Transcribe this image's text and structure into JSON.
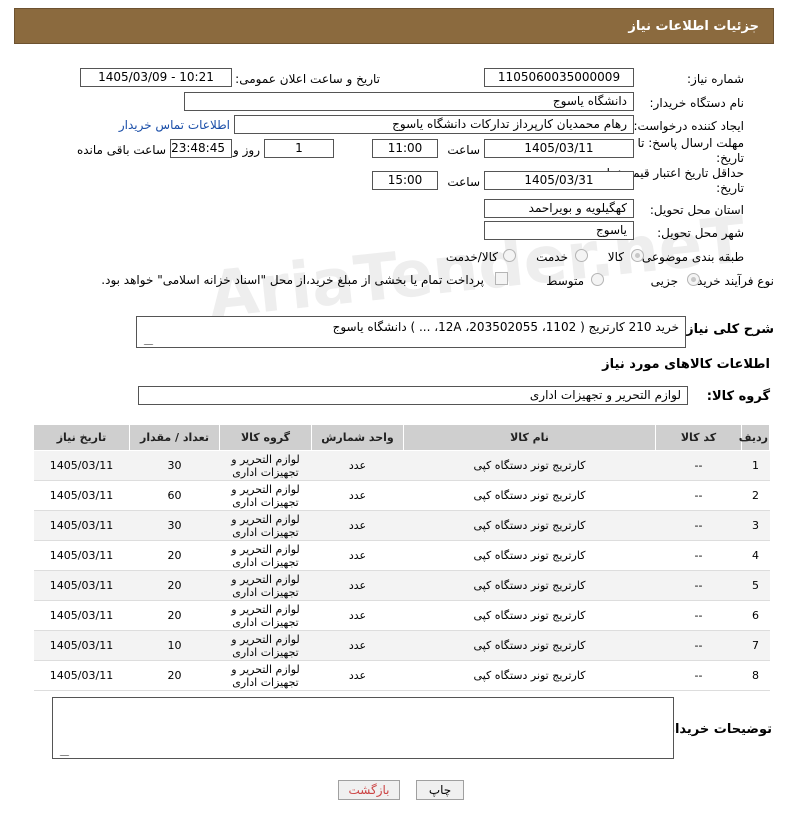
{
  "header": {
    "title": "جزئیات اطلاعات نیاز"
  },
  "fields": {
    "need_number_label": "شماره نیاز:",
    "need_number": "1105060035000009",
    "announce_label": "تاریخ و ساعت اعلان عمومی:",
    "announce_value": "1405/03/09 - 10:21",
    "buyer_org_label": "نام دستگاه خریدار:",
    "buyer_org": "دانشگاه یاسوج",
    "creator_label": "ایجاد کننده درخواست:",
    "creator": "رهام محمدیان کارپرداز تدارکات دانشگاه یاسوج",
    "contact_link": "اطلاعات تماس خریدار",
    "reply_deadline_label": "مهلت ارسال پاسخ: تا تاریخ:",
    "reply_date": "1405/03/11",
    "time_label": "ساعت",
    "reply_time": "11:00",
    "days_value": "1",
    "days_label": "روز و",
    "remaining_time": "23:48:45",
    "remaining_label": "ساعت باقی مانده",
    "price_deadline_label": "حداقل تاریخ اعتبار قیمت: تا تاریخ:",
    "price_date": "1405/03/31",
    "price_time": "15:00",
    "province_label": "استان محل تحویل:",
    "province": "کهگیلویه و بویراحمد",
    "city_label": "شهر محل تحویل:",
    "city": "یاسوج",
    "category_label": "طبقه بندی موضوعی:",
    "cat_goods": "کالا",
    "cat_service": "خدمت",
    "cat_both": "کالا/خدمت",
    "process_label": "نوع فرآیند خرید :",
    "proc_minor": "جزیی",
    "proc_medium": "متوسط",
    "payment_note": "پرداخت تمام یا بخشی از مبلغ خرید،از محل \"اسناد خزانه اسلامی\" خواهد بود.",
    "desc_label": "شرح کلی نیاز:",
    "desc_value": "خرید 210 کارتریج ( 1102، 203502055، 12A، ... ) دانشگاه یاسوج",
    "goods_info_title": "اطلاعات کالاهای مورد نیاز",
    "goods_group_label": "گروه کالا:",
    "goods_group": "لوازم التحریر و تجهیزات اداری",
    "buyer_notes_label": "توضیحات خریدار:"
  },
  "table": {
    "headers": [
      "ردیف",
      "کد کالا",
      "نام کالا",
      "واحد شمارش",
      "گروه کالا",
      "تعداد / مقدار",
      "تاریخ نیاز"
    ],
    "rows": [
      {
        "row": "1",
        "code": "--",
        "name": "کارتریج تونر دستگاه کپی",
        "unit": "عدد",
        "group": "لوازم التحریر و تجهیزات اداری",
        "qty": "30",
        "date": "1405/03/11"
      },
      {
        "row": "2",
        "code": "--",
        "name": "کارتریج تونر دستگاه کپی",
        "unit": "عدد",
        "group": "لوازم التحریر و تجهیزات اداری",
        "qty": "60",
        "date": "1405/03/11"
      },
      {
        "row": "3",
        "code": "--",
        "name": "کارتریج تونر دستگاه کپی",
        "unit": "عدد",
        "group": "لوازم التحریر و تجهیزات اداری",
        "qty": "30",
        "date": "1405/03/11"
      },
      {
        "row": "4",
        "code": "--",
        "name": "کارتریج تونر دستگاه کپی",
        "unit": "عدد",
        "group": "لوازم التحریر و تجهیزات اداری",
        "qty": "20",
        "date": "1405/03/11"
      },
      {
        "row": "5",
        "code": "--",
        "name": "کارتریج تونر دستگاه کپی",
        "unit": "عدد",
        "group": "لوازم التحریر و تجهیزات اداری",
        "qty": "20",
        "date": "1405/03/11"
      },
      {
        "row": "6",
        "code": "--",
        "name": "کارتریج تونر دستگاه کپی",
        "unit": "عدد",
        "group": "لوازم التحریر و تجهیزات اداری",
        "qty": "20",
        "date": "1405/03/11"
      },
      {
        "row": "7",
        "code": "--",
        "name": "کارتریج تونر دستگاه کپی",
        "unit": "عدد",
        "group": "لوازم التحریر و تجهیزات اداری",
        "qty": "10",
        "date": "1405/03/11"
      },
      {
        "row": "8",
        "code": "--",
        "name": "کارتریج تونر دستگاه کپی",
        "unit": "عدد",
        "group": "لوازم التحریر و تجهیزات اداری",
        "qty": "20",
        "date": "1405/03/11"
      }
    ]
  },
  "buttons": {
    "print": "چاپ",
    "back": "بازگشت"
  },
  "watermark": "AriaTender.neT"
}
